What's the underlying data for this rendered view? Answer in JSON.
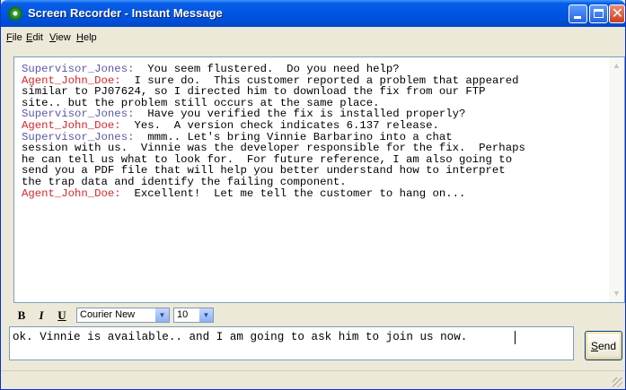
{
  "window": {
    "title": "Screen Recorder - Instant Message",
    "app_icon": "recorder-icon"
  },
  "title_buttons": {
    "minimize": "minimize-icon",
    "maximize": "maximize-icon",
    "close": "close-icon",
    "close_glyph": "✕"
  },
  "menu": {
    "items": [
      {
        "label": "File",
        "mnemonic": "F"
      },
      {
        "label": "Edit",
        "mnemonic": "E"
      },
      {
        "label": "View",
        "mnemonic": "V"
      },
      {
        "label": "Help",
        "mnemonic": "H"
      }
    ]
  },
  "chat": {
    "speakers": {
      "supervisor": "Supervisor_Jones:",
      "agent": "Agent_John_Doe:"
    },
    "lines": [
      {
        "speaker": "supervisor",
        "text": "Supervisor_Jones:  You seem flustered.  Do you need help?"
      },
      {
        "speaker": "agent",
        "text": "Agent_John_Doe:  I sure do.  This customer reported a problem that appeared"
      },
      {
        "speaker": "cont",
        "text": "similar to PJ07624, so I directed him to download the fix from our FTP"
      },
      {
        "speaker": "cont",
        "text": "site.. but the problem still occurs at the same place."
      },
      {
        "speaker": "supervisor",
        "text": "Supervisor_Jones:  Have you verified the fix is installed properly?"
      },
      {
        "speaker": "agent",
        "text": "Agent_John_Doe:  Yes.  A version check indicates 6.137 release."
      },
      {
        "speaker": "supervisor",
        "text": "Supervisor_Jones:  mmm.. Let's bring Vinnie Barbarino into a chat"
      },
      {
        "speaker": "cont",
        "text": "session with us.  Vinnie was the developer responsible for the fix.  Perhaps"
      },
      {
        "speaker": "cont",
        "text": "he can tell us what to look for.  For future reference, I am also going to"
      },
      {
        "speaker": "cont",
        "text": "send you a PDF file that will help you better understand how to interpret"
      },
      {
        "speaker": "cont",
        "text": "the trap data and identify the failing component."
      },
      {
        "speaker": "agent",
        "text": "Agent_John_Doe:  Excellent!  Let me tell the customer to hang on..."
      }
    ],
    "colors": {
      "supervisor": "#5b58a8",
      "agent": "#d3262a",
      "text": "#000000"
    }
  },
  "scrollbar": {
    "up_glyph": "▲",
    "down_glyph": "▼"
  },
  "format": {
    "bold_label": "B",
    "italic_label": "I",
    "underline_label": "U",
    "font": {
      "value": "Courier New",
      "arrow": "▼"
    },
    "size": {
      "value": "10",
      "arrow": "▼"
    }
  },
  "input": {
    "value": "ok. Vinnie is available.. and I am going to ask him to join us now."
  },
  "send": {
    "label_mnemonic": "S",
    "label_rest": "end"
  }
}
